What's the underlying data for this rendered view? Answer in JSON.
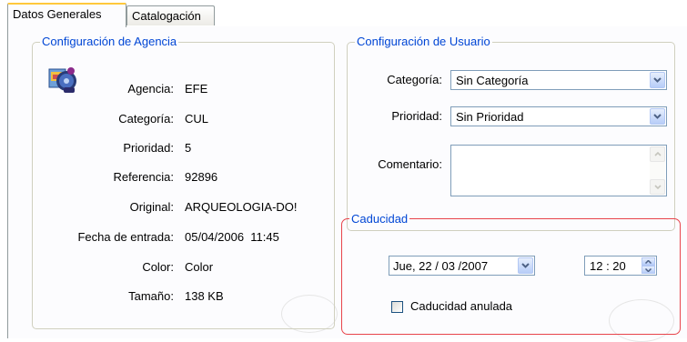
{
  "tabs": [
    {
      "label": "Datos Generales",
      "active": true
    },
    {
      "label": "Catalogación",
      "active": false
    }
  ],
  "agency": {
    "title": "Configuración de Agencia",
    "icon": "agency-media-icon",
    "rows": [
      {
        "label": "Agencia:",
        "value": "EFE"
      },
      {
        "label": "Categoría:",
        "value": "CUL"
      },
      {
        "label": "Prioridad:",
        "value": "5"
      },
      {
        "label": "Referencia:",
        "value": "92896"
      },
      {
        "label": "Original:",
        "value": "ARQUEOLOGIA-DO!"
      },
      {
        "label": "Fecha de entrada:",
        "value": "05/04/2006  11:45"
      },
      {
        "label": "Color:",
        "value": "Color"
      },
      {
        "label": "Tamaño:",
        "value": "138 KB"
      }
    ]
  },
  "user": {
    "title": "Configuración de Usuario",
    "category_label": "Categoría:",
    "category_value": "Sin Categoría",
    "priority_label": "Prioridad:",
    "priority_value": "Sin Prioridad",
    "comment_label": "Comentario:",
    "comment_value": ""
  },
  "expiry": {
    "title": "Caducidad",
    "date_value": "Jue, 22 / 03 /2007",
    "time_value": "12 : 20",
    "cancel_label": "Caducidad anulada",
    "cancel_checked": false,
    "highlight_color": "#e8444b"
  },
  "colors": {
    "group_title": "#0046d5",
    "tab_active_accent": "#ffc83c",
    "border": "#7f9db9"
  }
}
